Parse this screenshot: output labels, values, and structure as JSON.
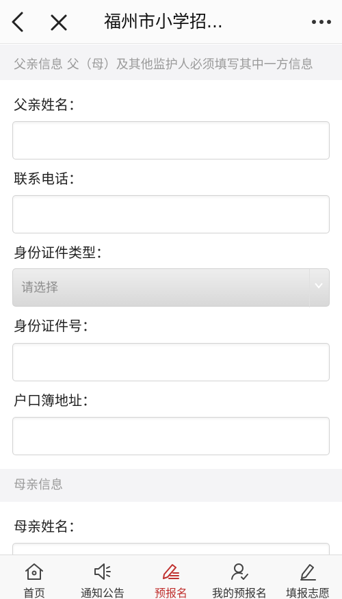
{
  "header": {
    "title": "福州市小学招..."
  },
  "father_section": {
    "header": "父亲信息 父（母）及其他监护人必须填写其中一方信息",
    "fields": {
      "name": {
        "label": "父亲姓名：",
        "value": ""
      },
      "phone": {
        "label": "联系电话：",
        "value": ""
      },
      "id_type": {
        "label": "身份证件类型：",
        "selected": "请选择"
      },
      "id_number": {
        "label": "身份证件号：",
        "value": ""
      },
      "address": {
        "label": "户口簿地址：",
        "value": ""
      }
    }
  },
  "mother_section": {
    "header": "母亲信息",
    "fields": {
      "name": {
        "label": "母亲姓名：",
        "value": ""
      }
    }
  },
  "tabbar": {
    "active_color": "#c0302e",
    "items": [
      {
        "label": "首页",
        "icon": "home-icon"
      },
      {
        "label": "通知公告",
        "icon": "speaker-icon"
      },
      {
        "label": "预报名",
        "icon": "edit-pen-icon",
        "active": true
      },
      {
        "label": "我的预报名",
        "icon": "user-check-icon"
      },
      {
        "label": "填报志愿",
        "icon": "pen-paper-icon"
      }
    ]
  }
}
